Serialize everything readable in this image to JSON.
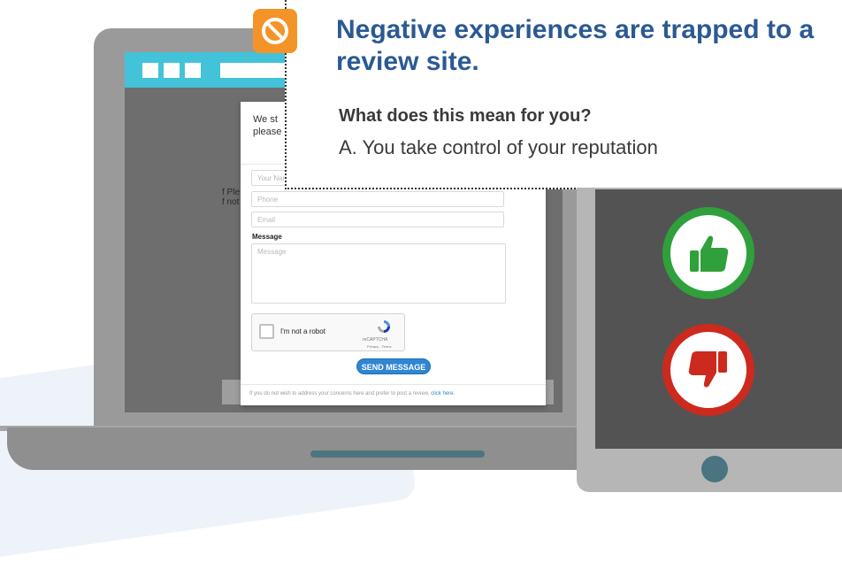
{
  "callout": {
    "title": "Negative experiences are trapped to a review site.",
    "question": "What does this mean for you?",
    "answer": "A. You take control of your reputation",
    "badge_icon": "blocked-icon",
    "badge_color": "#f49428"
  },
  "background_page": {
    "partial_text": "f Ple\nf not"
  },
  "form": {
    "intro": "We st\nplease",
    "name_placeholder": "Your Nam",
    "phone_placeholder": "Phone",
    "email_placeholder": "Email",
    "message_label": "Message",
    "message_placeholder": "Message",
    "captcha_label": "I'm not a robot",
    "captcha_brand": "reCAPTCHA",
    "captcha_terms": "Privacy - Terms",
    "send_label": "SEND MESSAGE",
    "footer_text": "If you do not wish to address your concerns here and prefer to post a review, ",
    "footer_link": "click here.",
    "button_color": "#2f86d2"
  },
  "tablet": {
    "thumbs_up_icon": "thumbs-up-icon",
    "thumbs_down_icon": "thumbs-down-icon",
    "up_color": "#2fa03b",
    "down_color": "#cc2a1e"
  },
  "colors": {
    "browser_bar": "#42c3d9",
    "title": "#2b5a92"
  }
}
